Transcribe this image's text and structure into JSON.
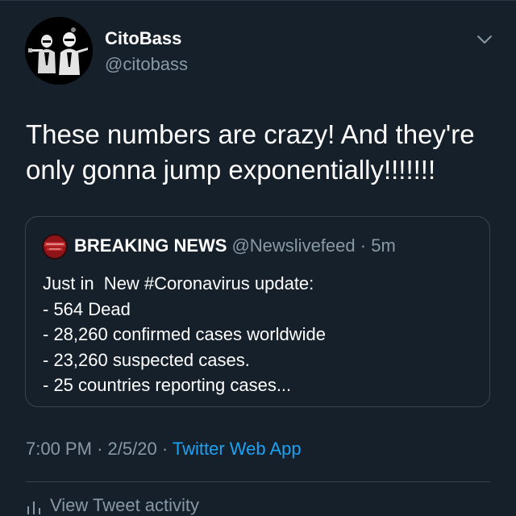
{
  "tweet": {
    "author": {
      "display_name": "CitoBass",
      "handle": "@citobass",
      "avatar_icon": "pulp-fiction-stormtroopers-avatar"
    },
    "menu_icon": "chevron-down-icon",
    "text": "These numbers are crazy! And they're only gonna jump exponentially!!!!!!!",
    "quoted": {
      "author": {
        "display_name": "BREAKING NEWS",
        "handle": "@Newslivefeed",
        "time": "5m",
        "avatar_text": "BREAKING NEWS"
      },
      "separator": "·",
      "lines": [
        "Just in  New #Coronavirus update:",
        "- 564 Dead",
        "- 28,260 confirmed cases worldwide",
        "- 23,260 suspected cases.",
        "- 25 countries reporting cases..."
      ]
    },
    "meta": {
      "time": "7:00 PM",
      "date": "2/5/20",
      "separator": "·",
      "app": "Twitter Web App"
    },
    "activity": {
      "label": "View Tweet activity",
      "icon": "bar-chart-icon"
    }
  },
  "colors": {
    "background": "#15202b",
    "primary_text": "#ffffff",
    "secondary_text": "#8899a6",
    "link": "#1da1f2",
    "border": "#38444d",
    "breaking_red": "#c0282c"
  }
}
